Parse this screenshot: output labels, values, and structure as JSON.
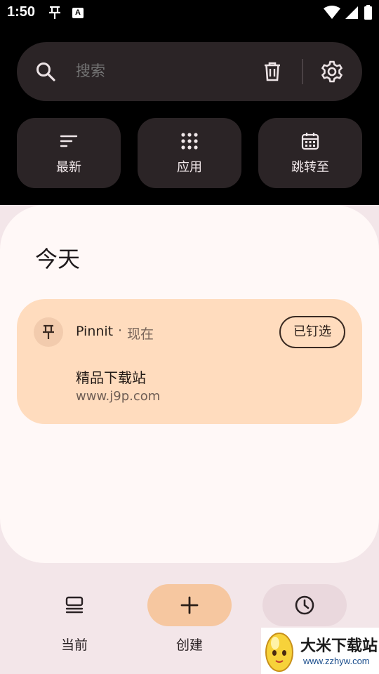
{
  "status_bar": {
    "time": "1:50",
    "notification_icons": [
      "pin-icon",
      "a-icon"
    ],
    "system_icons": [
      "wifi-icon",
      "signal-icon",
      "battery-icon"
    ]
  },
  "search": {
    "placeholder": "搜索",
    "icons": [
      "search-icon",
      "trash-icon",
      "gear-icon"
    ]
  },
  "quick_actions": [
    {
      "label": "最新",
      "icon": "sort-icon"
    },
    {
      "label": "应用",
      "icon": "apps-grid-icon"
    },
    {
      "label": "跳转至",
      "icon": "calendar-icon"
    }
  ],
  "section": {
    "title": "今天"
  },
  "notification": {
    "app": "Pinnit",
    "separator": "·",
    "time": "现在",
    "pinned_label": "已钉选",
    "title": "精品下载站",
    "body": "www.j9p.com"
  },
  "bottom_nav": [
    {
      "label": "当前",
      "icon": "stack-icon"
    },
    {
      "label": "创建",
      "icon": "plus-icon",
      "selected": true
    },
    {
      "label": "",
      "icon": "clock-icon"
    }
  ],
  "watermark": {
    "title": "大米下载站",
    "url": "www.zzhyw.com"
  },
  "colors": {
    "background": "#000000",
    "surface_dark": "#2b2426",
    "sheet": "#fff8f7",
    "card": "#ffdcbe",
    "nav_selected": "#f6c7a0",
    "nav_history": "#ead8dd"
  }
}
